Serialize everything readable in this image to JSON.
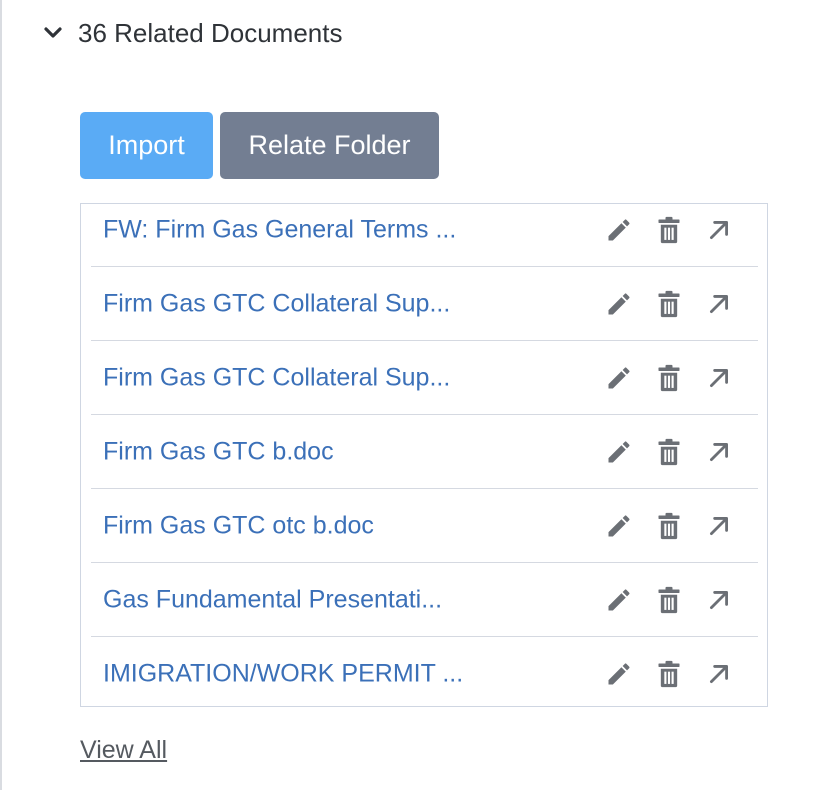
{
  "section": {
    "title": "36 Related Documents",
    "icon": "chevron-down-icon"
  },
  "buttons": {
    "import_label": "Import",
    "relate_folder_label": "Relate Folder"
  },
  "documents": [
    {
      "name": "FW: Firm Gas General Terms ..."
    },
    {
      "name": "Firm Gas GTC Collateral Sup..."
    },
    {
      "name": "Firm Gas GTC Collateral Sup..."
    },
    {
      "name": "Firm Gas GTC b.doc"
    },
    {
      "name": "Firm Gas GTC otc b.doc"
    },
    {
      "name": "Gas Fundamental Presentati..."
    },
    {
      "name": "IMIGRATION/WORK PERMIT ..."
    }
  ],
  "row_icons": [
    "pencil-icon",
    "trash-icon",
    "open-arrow-icon"
  ],
  "view_all_label": "View All",
  "colors": {
    "import_button": "#5aabf5",
    "relate_button": "#737e92",
    "link": "#3b70b8",
    "icon": "#6b6f75"
  }
}
